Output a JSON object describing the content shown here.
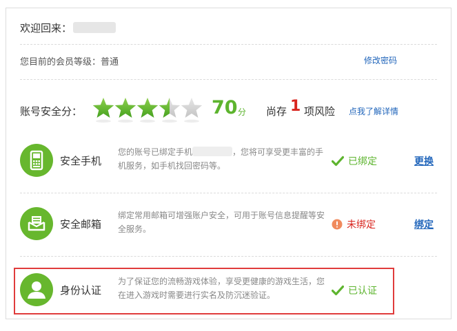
{
  "header": {
    "welcome_label": "欢迎回来：",
    "level_label": "您目前的会员等级：",
    "level_value": "普通",
    "change_password": "修改密码"
  },
  "security": {
    "score_label": "账号安全分：",
    "stars_filled": 3.5,
    "stars_total": 5,
    "score": "70",
    "score_unit": "分",
    "risk_prefix": "尚存",
    "risk_count": "1",
    "risk_suffix": "项风险",
    "detail_link": "点我了解详情"
  },
  "items": [
    {
      "title": "安全手机",
      "desc_a": "您的账号已绑定手机",
      "desc_b": "，您将可享受更丰富的手机服务，如手机找回密码等。",
      "status": "已绑定",
      "action": "更换"
    },
    {
      "title": "安全邮箱",
      "desc": "绑定常用邮箱可增强账户安全，可用于账号信息提醒等安全服务。",
      "status": "未绑定",
      "action": "绑定"
    },
    {
      "title": "身份认证",
      "desc": "为了保证您的流畅游戏体验，享受更健康的游戏生活，您在进入游戏时需要进行实名及防沉迷验证。",
      "status": "已认证"
    }
  ],
  "colors": {
    "accent_green": "#5db42e",
    "risk_red": "#d8241e",
    "link_blue": "#2266bb",
    "highlight_border": "#e03b3b"
  },
  "icons": {
    "phone": "phone-icon",
    "email": "email-icon",
    "identity": "user-icon",
    "ok": "check-icon",
    "warning": "warning-icon"
  }
}
